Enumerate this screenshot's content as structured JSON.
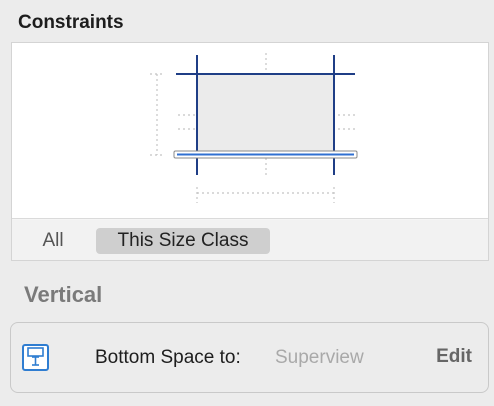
{
  "section": {
    "title": "Constraints"
  },
  "size_class_tabs": [
    {
      "label": "All",
      "selected": false
    },
    {
      "label": "This Size Class",
      "selected": true
    }
  ],
  "vertical": {
    "title": "Vertical"
  },
  "constraint": {
    "icon": "bottom-space-constraint-icon",
    "label": "Bottom Space to:",
    "value": "Superview",
    "edit_label": "Edit"
  },
  "colors": {
    "constraint_line": "#1f3e86",
    "icon_blue": "#2f7dd1",
    "view_fill": "#ebebeb"
  }
}
